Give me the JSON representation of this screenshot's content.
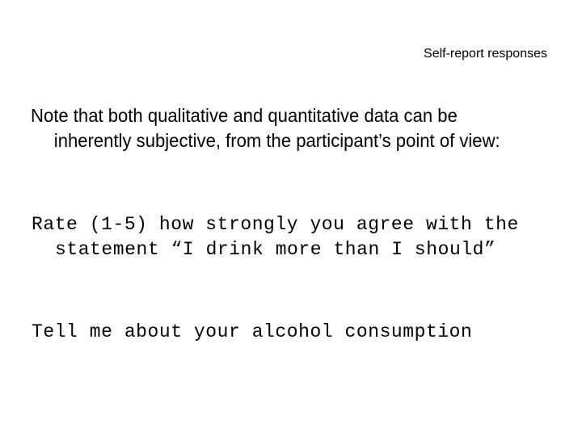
{
  "slide": {
    "title": "Self-report responses",
    "background_color": "#ffffff",
    "text_color": "#000000",
    "body_paragraph": "Note that both qualitative and quantitative data can be inherently subjective, from the participant’s point of view:",
    "example_question_1": "Rate (1-5) how strongly you agree with the statement “I drink more than I should”",
    "example_question_2": "Tell me about your alcohol consumption"
  }
}
